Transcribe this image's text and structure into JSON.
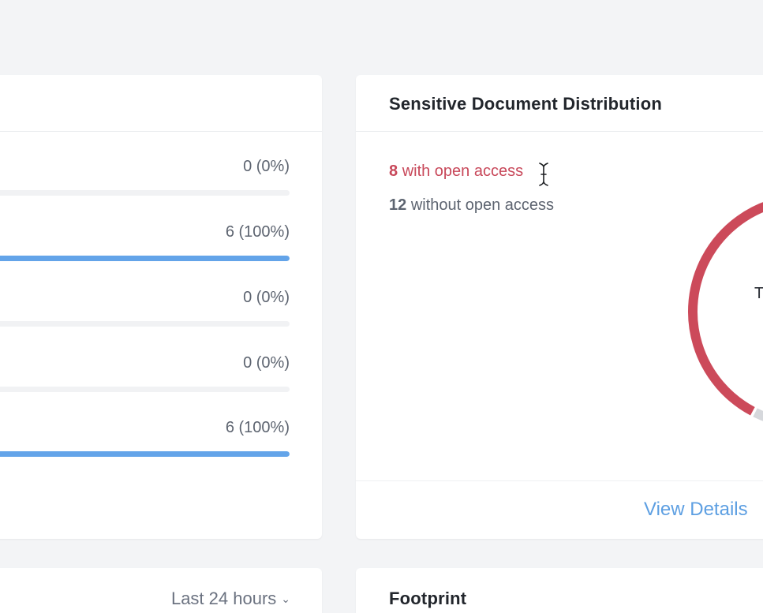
{
  "left_card": {
    "bars": [
      {
        "value_text": "0 (0%)",
        "percent": 0
      },
      {
        "value_text": "6 (100%)",
        "percent": 100
      },
      {
        "value_text": "0 (0%)",
        "percent": 0
      },
      {
        "value_text": "0 (0%)",
        "percent": 0
      },
      {
        "value_text": "6 (100%)",
        "percent": 100
      }
    ]
  },
  "distribution_card": {
    "title": "Sensitive Document Distribution",
    "open_count": "8",
    "open_label": "with open access",
    "closed_count": "12",
    "closed_label": "without open access",
    "center_label": "T",
    "view_details": "View Details",
    "open_color": "#cc4a5a",
    "closed_color": "#d6d8dc"
  },
  "bottom_left_card": {
    "range_label": "Last 24 hours",
    "chevron_icon": "chevron-down-icon"
  },
  "bottom_right_card": {
    "title": "Footprint"
  }
}
